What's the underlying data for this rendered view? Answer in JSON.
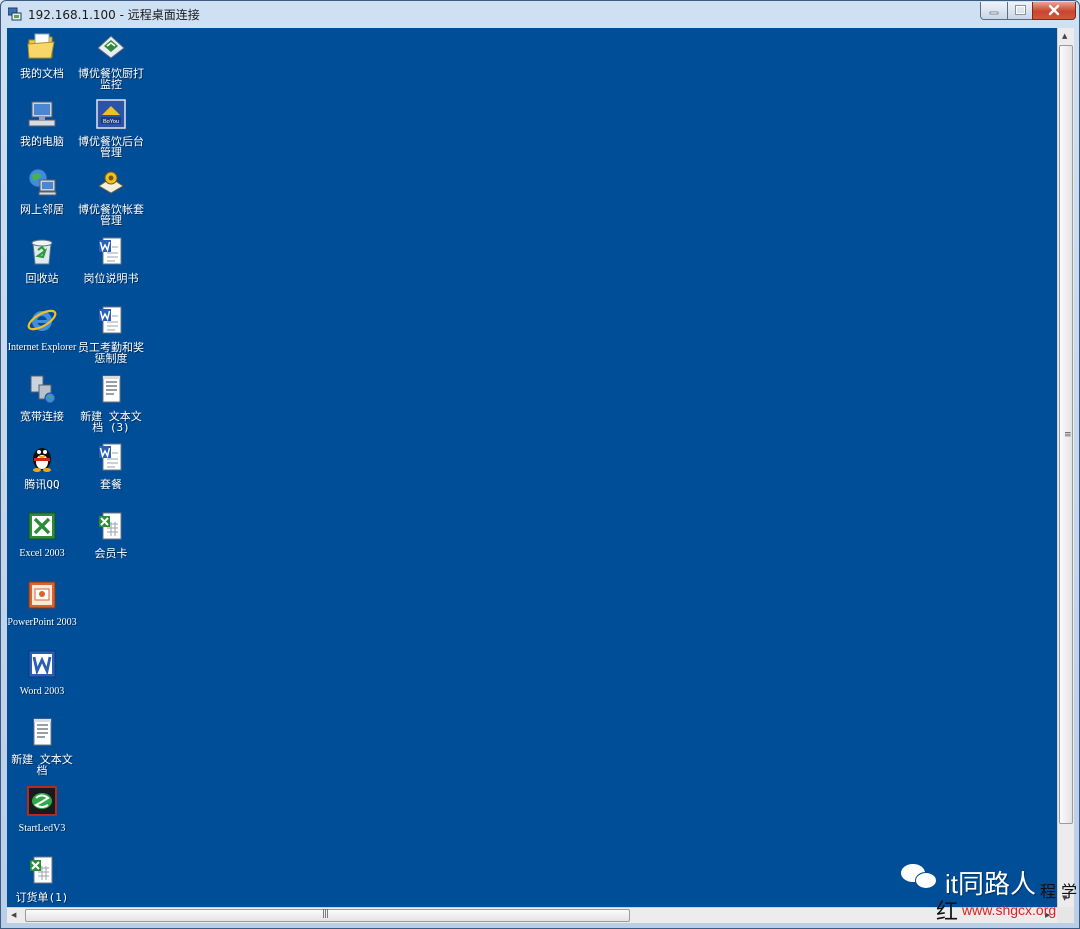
{
  "window": {
    "title": "192.168.1.100 - 远程桌面连接"
  },
  "desktop": {
    "background": "#004e98",
    "icons": [
      {
        "id": "my-documents",
        "label": "我的文档",
        "icon": "folder-documents-icon"
      },
      {
        "id": "my-computer",
        "label": "我的电脑",
        "icon": "computer-icon"
      },
      {
        "id": "network",
        "label": "网上邻居",
        "icon": "network-places-icon"
      },
      {
        "id": "recycle-bin",
        "label": "回收站",
        "icon": "recycle-bin-icon"
      },
      {
        "id": "internet-explorer",
        "label": "Internet Explorer",
        "icon": "internet-explorer-icon"
      },
      {
        "id": "broadband",
        "label": "宽带连接",
        "icon": "broadband-connection-icon"
      },
      {
        "id": "qq",
        "label": "腾讯QQ",
        "icon": "qq-penguin-icon"
      },
      {
        "id": "excel-2003",
        "label": "Excel 2003",
        "icon": "excel-icon"
      },
      {
        "id": "powerpoint-2003",
        "label": "PowerPoint 2003",
        "icon": "powerpoint-icon"
      },
      {
        "id": "word-2003",
        "label": "Word 2003",
        "icon": "word-icon"
      },
      {
        "id": "new-text-doc",
        "label": "新建 文本文档",
        "icon": "text-document-icon"
      },
      {
        "id": "startled",
        "label": "StartLedV3",
        "icon": "startled-app-icon"
      },
      {
        "id": "order-sheet",
        "label": "订货单(1)",
        "icon": "excel-document-icon"
      },
      {
        "id": "kitchen-print",
        "label": "博优餐饮厨打监控",
        "icon": "kitchen-print-monitor-icon"
      },
      {
        "id": "backend-mgmt",
        "label": "博优餐饮后台管理",
        "icon": "boyou-backend-icon"
      },
      {
        "id": "account-mgmt",
        "label": "博优餐饮帐套管理",
        "icon": "account-set-icon"
      },
      {
        "id": "job-desc",
        "label": "岗位说明书",
        "icon": "word-document-icon"
      },
      {
        "id": "attendance",
        "label": "员工考勤和奖惩制度",
        "icon": "word-document-icon"
      },
      {
        "id": "new-text-doc-3",
        "label": "新建 文本文档 (3)",
        "icon": "text-document-icon"
      },
      {
        "id": "set-meal",
        "label": "套餐",
        "icon": "word-document-icon"
      },
      {
        "id": "member-card",
        "label": "会员卡",
        "icon": "excel-document-icon"
      }
    ]
  },
  "watermark": {
    "name": "it同路人",
    "url": "www.shgcx.org",
    "side_chars": "程 学",
    "mark": "红"
  },
  "colors": {
    "desktop": "#004e98",
    "close_button": "#c8452f",
    "watermark_url": "#e02020"
  }
}
